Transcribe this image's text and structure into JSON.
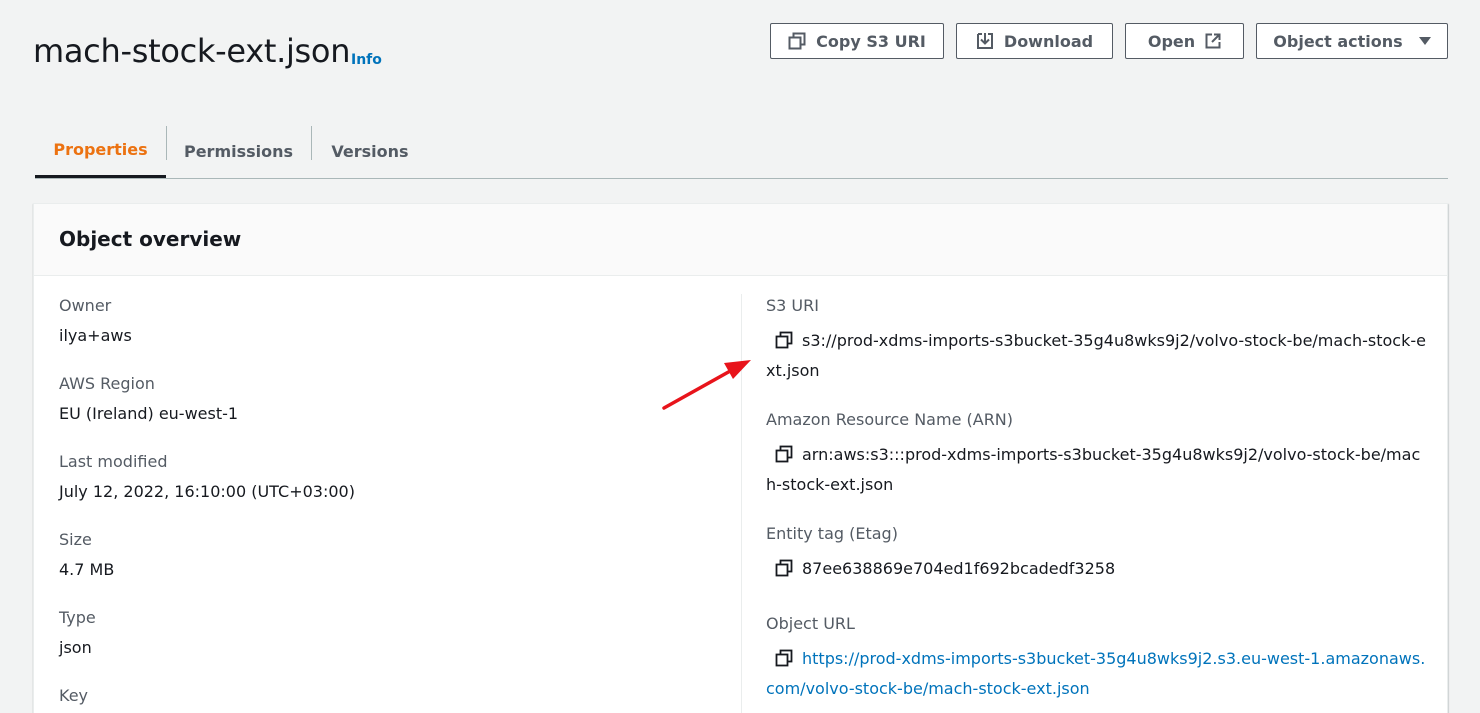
{
  "header": {
    "title": "mach-stock-ext.json",
    "info_label": "Info"
  },
  "actions": {
    "copy_s3_uri": "Copy S3 URI",
    "download": "Download",
    "open": "Open",
    "object_actions": "Object actions"
  },
  "tabs": [
    {
      "label": "Properties",
      "active": true
    },
    {
      "label": "Permissions",
      "active": false
    },
    {
      "label": "Versions",
      "active": false
    }
  ],
  "overview": {
    "title": "Object overview",
    "left": [
      {
        "label": "Owner",
        "value": "ilya+aws"
      },
      {
        "label": "AWS Region",
        "value": "EU (Ireland) eu-west-1"
      },
      {
        "label": "Last modified",
        "value": "July 12, 2022, 16:10:00 (UTC+03:00)"
      },
      {
        "label": "Size",
        "value": "4.7 MB"
      },
      {
        "label": "Type",
        "value": "json"
      },
      {
        "label": "Key",
        "value": ""
      }
    ],
    "right": {
      "s3_uri_label": "S3 URI",
      "s3_uri": "s3://prod-xdms-imports-s3bucket-35g4u8wks9j2/volvo-stock-be/mach-stock-ext.json",
      "arn_label": "Amazon Resource Name (ARN)",
      "arn": "arn:aws:s3:::prod-xdms-imports-s3bucket-35g4u8wks9j2/volvo-stock-be/mach-stock-ext.json",
      "etag_label": "Entity tag (Etag)",
      "etag": "87ee638869e704ed1f692bcadedf3258",
      "object_url_label": "Object URL",
      "object_url": "https://prod-xdms-imports-s3bucket-35g4u8wks9j2.s3.eu-west-1.amazonaws.com/volvo-stock-be/mach-stock-ext.json"
    }
  },
  "colors": {
    "accent_orange": "#ec7211",
    "link_blue": "#0073bb",
    "annotation_red": "#e8141b"
  },
  "icons": {
    "copy": "copy-icon",
    "download": "download-icon",
    "external": "external-link-icon",
    "caret": "caret-down-icon"
  }
}
